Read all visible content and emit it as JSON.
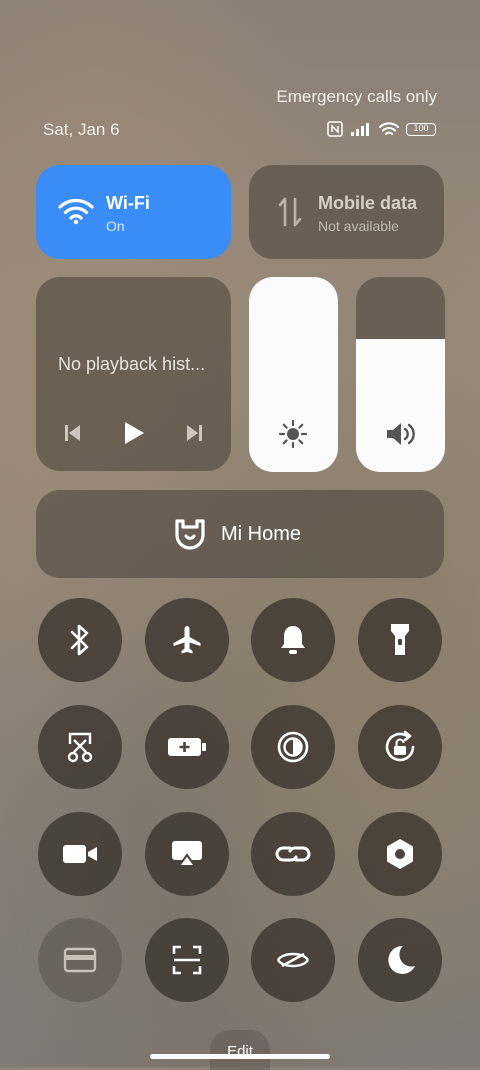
{
  "status": {
    "network_text": "Emergency calls only",
    "date": "Sat, Jan 6",
    "battery": "100"
  },
  "wifi": {
    "title": "Wi-Fi",
    "subtitle": "On",
    "active_color": "#3a8cf6"
  },
  "mobile_data": {
    "title": "Mobile data",
    "subtitle": "Not available"
  },
  "media": {
    "text": "No playback hist..."
  },
  "brightness": {
    "level": 1.0
  },
  "volume": {
    "level": 0.68
  },
  "mi_home": {
    "label": "Mi Home"
  },
  "toggles": [
    {
      "name": "bluetooth",
      "icon": "bluetooth-icon"
    },
    {
      "name": "airplane-mode",
      "icon": "airplane-icon"
    },
    {
      "name": "sound",
      "icon": "bell-icon"
    },
    {
      "name": "flashlight",
      "icon": "flashlight-icon"
    },
    {
      "name": "screenshot",
      "icon": "scissors-icon"
    },
    {
      "name": "battery-saver",
      "icon": "battery-plus-icon"
    },
    {
      "name": "dark-mode",
      "icon": "contrast-icon"
    },
    {
      "name": "rotation-lock",
      "icon": "rotate-lock-icon"
    },
    {
      "name": "screen-recorder",
      "icon": "video-camera-icon"
    },
    {
      "name": "cast",
      "icon": "cast-icon"
    },
    {
      "name": "link",
      "icon": "link-icon"
    },
    {
      "name": "settings",
      "icon": "hexagon-settings-icon"
    },
    {
      "name": "card",
      "icon": "card-icon"
    },
    {
      "name": "scanner",
      "icon": "scan-icon"
    },
    {
      "name": "reading-mode",
      "icon": "eye-slash-icon"
    },
    {
      "name": "do-not-disturb",
      "icon": "moon-icon"
    }
  ],
  "edit": {
    "label": "Edit"
  }
}
